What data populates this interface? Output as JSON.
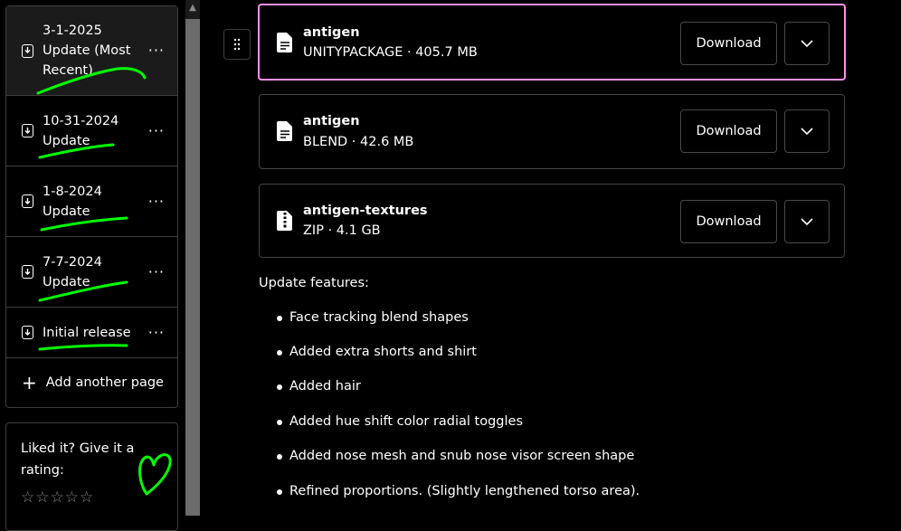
{
  "sidebar": {
    "pages": [
      {
        "label": "3-1-2025 Update (Most Recent)",
        "active": true
      },
      {
        "label": "10-31-2024 Update",
        "active": false
      },
      {
        "label": "1-8-2024 Update",
        "active": false
      },
      {
        "label": "7-7-2024 Update",
        "active": false
      },
      {
        "label": "Initial release",
        "active": false
      }
    ],
    "more_glyph": "···",
    "add_page_label": "Add another page"
  },
  "rating": {
    "text": "Liked it? Give it a rating:",
    "stars": "☆☆☆☆☆",
    "max_stars": 5
  },
  "files": [
    {
      "name": "antigen",
      "meta": "UNITYPACKAGE · 405.7 MB",
      "icon": "file-document-icon",
      "button": "Download"
    },
    {
      "name": "antigen",
      "meta": "BLEND · 42.6 MB",
      "icon": "file-document-icon",
      "button": "Download"
    },
    {
      "name": "antigen-textures",
      "meta": "ZIP · 4.1 GB",
      "icon": "file-zip-icon",
      "button": "Download"
    }
  ],
  "features": {
    "title": "Update features:",
    "items": [
      "Face tracking blend shapes",
      "Added extra shorts and shirt",
      "Added hair",
      "Added hue shift color radial toggles",
      "Added nose mesh and snub nose visor screen shape",
      "Refined proportions. (Slightly lengthened torso area)."
    ]
  },
  "colors": {
    "background": "#000000",
    "highlight_border": "#ff90e8",
    "border": "#3d3d3d",
    "annotation": "#00ff00"
  }
}
